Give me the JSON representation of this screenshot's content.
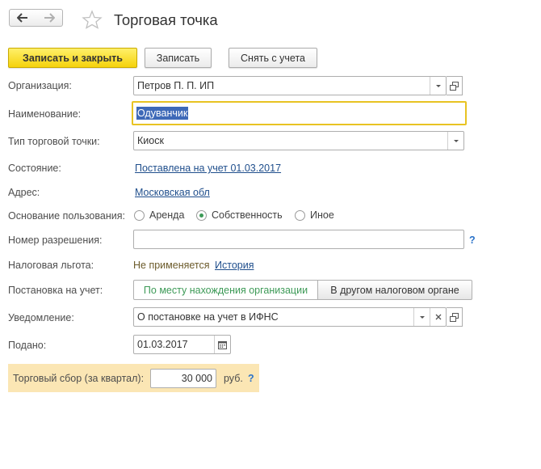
{
  "header": {
    "title": "Торговая точка",
    "back_icon": "arrow-left-icon",
    "forward_icon": "arrow-right-icon",
    "favorite_icon": "star-icon"
  },
  "toolbar": {
    "save_close_label": "Записать и закрыть",
    "save_label": "Записать",
    "deregister_label": "Снять с учета"
  },
  "form": {
    "organization": {
      "label": "Организация:",
      "value": "Петров П. П. ИП"
    },
    "name": {
      "label": "Наименование:",
      "value": "Одуванчик"
    },
    "point_type": {
      "label": "Тип торговой точки:",
      "value": "Киоск"
    },
    "state": {
      "label": "Состояние:",
      "value": "Поставлена на учет 01.03.2017"
    },
    "address": {
      "label": "Адрес:",
      "value": "Московская обл"
    },
    "usage_basis": {
      "label": "Основание пользования:",
      "options": [
        "Аренда",
        "Собственность",
        "Иное"
      ],
      "selected": "Собственность"
    },
    "permit_number": {
      "label": "Номер разрешения:",
      "value": "",
      "help": "?"
    },
    "tax_benefit": {
      "label": "Налоговая льгота:",
      "value": "Не применяется",
      "link": "История"
    },
    "registration": {
      "label": "Постановка на учет:",
      "options": [
        "По месту нахождения организации",
        "В другом налоговом органе"
      ],
      "selected": "По месту нахождения организации"
    },
    "notice": {
      "label": "Уведомление:",
      "value": "О постановке на учет в ИФНС"
    },
    "submitted": {
      "label": "Подано:",
      "value": "01.03.2017"
    },
    "trade_fee": {
      "label": "Торговый сбор (за квартал):",
      "value": "30 000",
      "unit": "руб.",
      "help": "?"
    }
  },
  "colors": {
    "primary_button": "#f5d20c",
    "focus_border": "#e8c322",
    "selection": "#3e69b8",
    "link": "#1f4e8c",
    "radio_selected": "#3d9a57",
    "fee_panel": "#fbe6b4"
  }
}
